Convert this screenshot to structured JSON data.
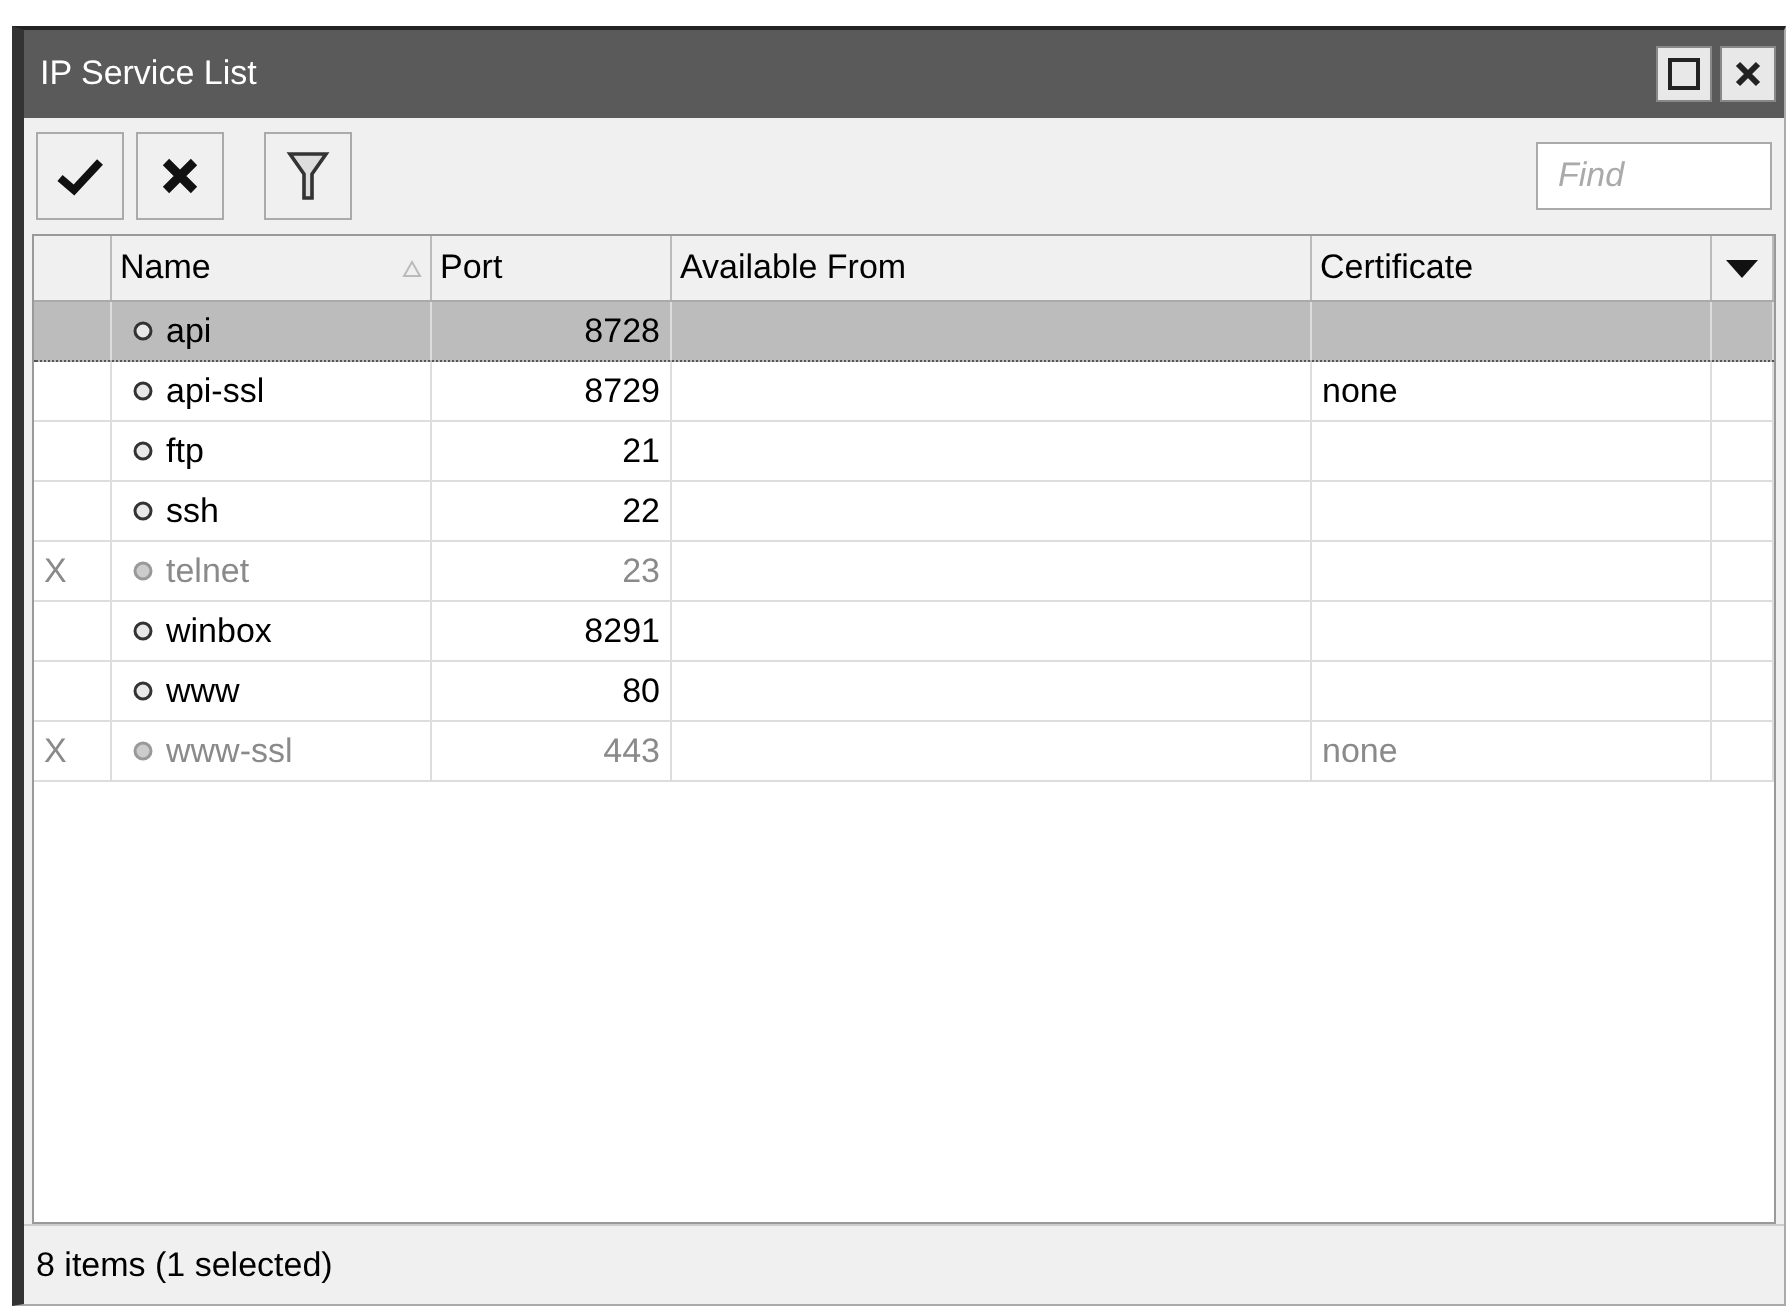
{
  "window": {
    "title": "IP Service List"
  },
  "toolbar": {
    "search": {
      "placeholder": "Find"
    }
  },
  "table": {
    "columns": [
      "Name",
      "Port",
      "Available From",
      "Certificate"
    ],
    "rows": [
      {
        "name": "api",
        "port": "8728",
        "available_from": "",
        "certificate": "",
        "disabled": false,
        "selected": true
      },
      {
        "name": "api-ssl",
        "port": "8729",
        "certificate": "none",
        "disabled": false,
        "selected": false
      },
      {
        "name": "ftp",
        "port": "21",
        "disabled": false,
        "selected": false
      },
      {
        "name": "ssh",
        "port": "22",
        "disabled": false,
        "selected": false
      },
      {
        "flag": "X",
        "name": "telnet",
        "port": "23",
        "disabled": true,
        "selected": false
      },
      {
        "name": "winbox",
        "port": "8291",
        "disabled": false,
        "selected": false
      },
      {
        "name": "www",
        "port": "80",
        "disabled": false,
        "selected": false
      },
      {
        "flag": "X",
        "name": "www-ssl",
        "port": "443",
        "certificate": "none",
        "disabled": true,
        "selected": false
      }
    ]
  },
  "status_bar": "8 items (1 selected)"
}
